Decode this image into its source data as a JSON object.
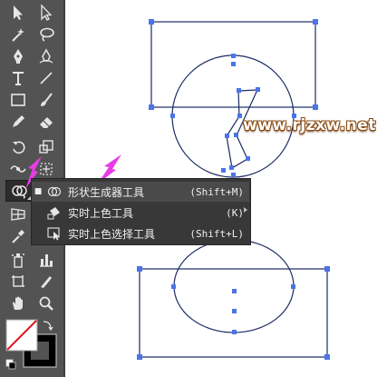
{
  "toolbar": {
    "tools": [
      "selection-tool",
      "direct-selection-tool",
      "magic-wand-tool",
      "lasso-tool",
      "pen-tool",
      "curvature-tool",
      "type-tool",
      "line-segment-tool",
      "rectangle-tool",
      "paintbrush-tool",
      "pencil-tool",
      "eraser-tool",
      "rotate-tool",
      "scale-tool",
      "width-tool",
      "free-transform-tool",
      "shape-builder-tool",
      "perspective-grid-tool",
      "mesh-tool",
      "gradient-tool",
      "eyedropper-tool",
      "blend-tool",
      "symbol-sprayer-tool",
      "column-graph-tool",
      "artboard-tool",
      "slice-tool",
      "hand-tool",
      "zoom-tool"
    ],
    "active_tool": "shape-builder-tool"
  },
  "flyout": {
    "items": [
      {
        "label": "形状生成器工具",
        "shortcut": "(Shift+M)",
        "selected": true,
        "icon": "shape-builder-icon"
      },
      {
        "label": "实时上色工具",
        "shortcut": "(K)",
        "selected": false,
        "icon": "live-paint-bucket-icon"
      },
      {
        "label": "实时上色选择工具",
        "shortcut": "(Shift+L)",
        "selected": false,
        "icon": "live-paint-selection-icon"
      }
    ]
  },
  "colors": {
    "toolbar_bg": "#535353",
    "flyout_bg": "#383838",
    "path_stroke": "#1b2a63",
    "anchor": "#4a74e8",
    "pointer_arrow": "#e83ce8"
  },
  "watermark": {
    "text": "www.rjzxw.net"
  }
}
